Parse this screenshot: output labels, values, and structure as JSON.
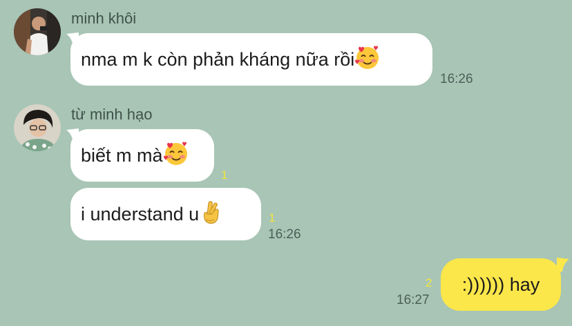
{
  "chat": {
    "groups": [
      {
        "sender": "minh khôi",
        "messages": [
          {
            "text": "nma m k còn phản kháng nữa rồi ",
            "emoji": "smiling-face-with-hearts-icon",
            "time": "16:26"
          }
        ]
      },
      {
        "sender": "từ minh hạo",
        "messages": [
          {
            "text": "biết m mà",
            "emoji": "smiling-face-with-hearts-icon",
            "read_count": "1"
          },
          {
            "text": "i understand u ",
            "emoji": "crossed-fingers-icon",
            "read_count": "1",
            "time": "16:26"
          }
        ]
      }
    ],
    "outgoing": [
      {
        "text": ":)))))) hay",
        "read_count": "2",
        "time": "16:27"
      }
    ]
  },
  "colors": {
    "background": "#a8c5b6",
    "incoming_bubble": "#ffffff",
    "outgoing_bubble": "#fbe74a",
    "read_count": "#f5e63a"
  }
}
